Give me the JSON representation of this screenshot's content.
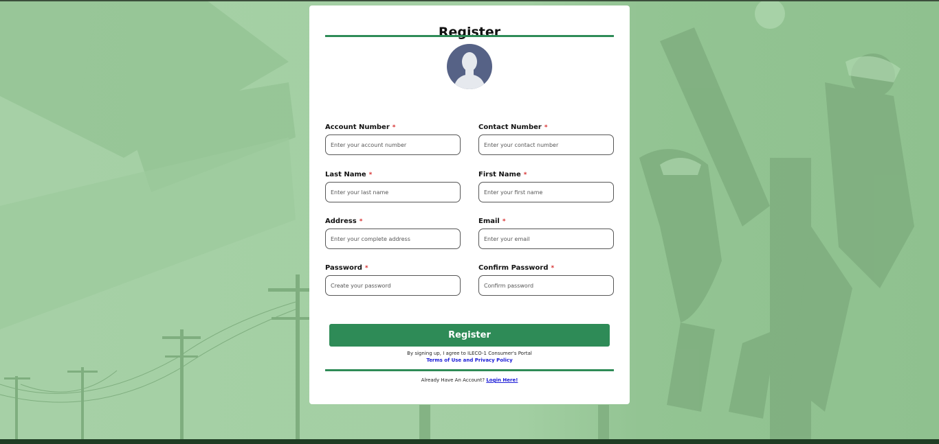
{
  "form": {
    "title": "Register",
    "fields": [
      {
        "label": "Account Number",
        "required_mark": "*",
        "placeholder": "Enter your account number"
      },
      {
        "label": "Contact Number",
        "required_mark": "*",
        "placeholder": "Enter your contact number"
      },
      {
        "label": "Last Name",
        "required_mark": "*",
        "placeholder": "Enter your last name"
      },
      {
        "label": "First Name",
        "required_mark": "*",
        "placeholder": "Enter your first name"
      },
      {
        "label": "Address",
        "required_mark": "*",
        "placeholder": "Enter your complete address"
      },
      {
        "label": "Email",
        "required_mark": "*",
        "placeholder": "Enter your email"
      },
      {
        "label": "Password",
        "required_mark": "*",
        "placeholder": "Create your password"
      },
      {
        "label": "Confirm Password",
        "required_mark": "*",
        "placeholder": "Confirm password"
      }
    ],
    "submit_label": "Register",
    "agreement_text": "By signing up, I agree to ILECO-1 Consumer's Portal",
    "agreement_link": "Terms of Use and Privacy Policy",
    "login_prompt": "Already Have An Account?",
    "login_link": "Login Here!"
  },
  "icons": {
    "avatar": "user-avatar-icon"
  },
  "colors": {
    "accent": "#2e8b57",
    "background": "#a6d0a6",
    "avatar_bg": "#566286",
    "required": "#d63030",
    "link": "#1a1ad6"
  }
}
